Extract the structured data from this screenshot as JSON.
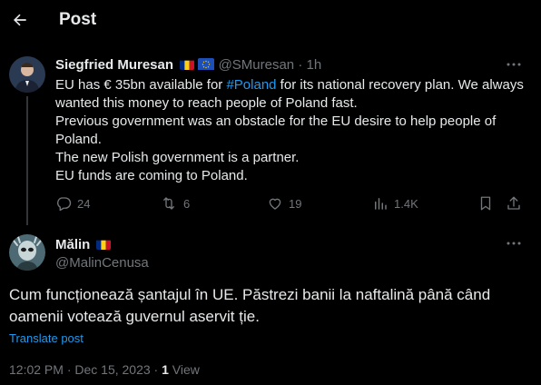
{
  "header": {
    "title": "Post"
  },
  "original_tweet": {
    "author_name": "Siegfried Muresan",
    "handle": "@SMuresan",
    "separator": "·",
    "time": "1h",
    "text": {
      "line1_pre": "EU has € 35bn available for ",
      "hashtag": "#Poland",
      "line1_post": " for its national recovery plan. We always wanted this money to reach people of Poland fast.",
      "para2": "Previous government was an obstacle for the EU desire to help people of Poland.",
      "para3": "The new Polish government is a partner.",
      "para4": "EU funds are coming to Poland."
    },
    "stats": {
      "replies": "24",
      "reposts": "6",
      "likes": "19",
      "views": "1.4K"
    }
  },
  "reply_tweet": {
    "author_name": "Mălin",
    "handle": "@MalinCenusa",
    "text": "Cum funcționează șantajul în UE. Păstrezi banii la naftalină până când oamenii votează guvernul aservit ție.",
    "translate_label": "Translate post",
    "timestamp": "12:02 PM · Dec 15, 2023",
    "dot": "·",
    "view_count": "1",
    "view_label": "View"
  },
  "colors": {
    "accent": "#1d9bf0",
    "text": "#e7e9ea",
    "muted": "#71767b",
    "background": "#000000"
  },
  "icons": [
    "back-arrow-icon",
    "more-icon",
    "reply-icon",
    "repost-icon",
    "like-icon",
    "views-icon",
    "bookmark-icon",
    "share-icon"
  ]
}
